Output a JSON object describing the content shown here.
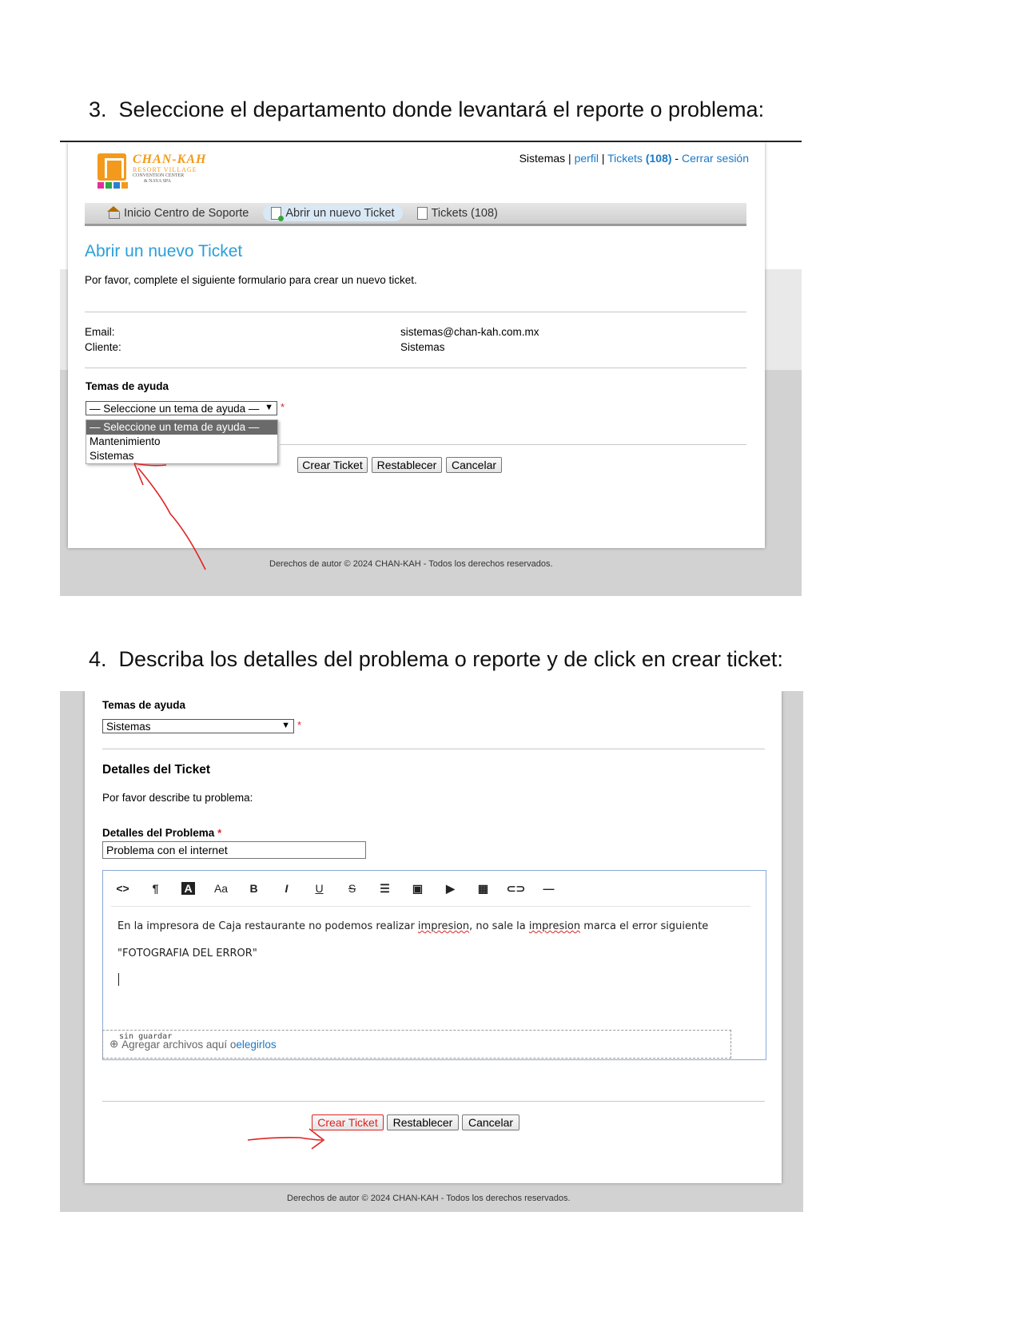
{
  "step3": {
    "number": "3.",
    "heading": "Seleccione el departamento donde levantará el reporte o problema:"
  },
  "step4": {
    "number": "4.",
    "heading": "Describa los detalles del problema o reporte y de click en crear ticket:"
  },
  "logo": {
    "name": "CHAN-KAH",
    "sub1": "RESORT VILLAGE",
    "sub2": "CONVENTION CENTER",
    "sub3": "& NAYA SPA",
    "colors": [
      "#f39a1c",
      "#2aa84a",
      "#e0309a",
      "#2f7fd0"
    ]
  },
  "topbar": {
    "user": "Sistemas",
    "sep1": "|",
    "profile": "perfil",
    "sep2": "|",
    "tickets": "Tickets",
    "tickets_count": "(108)",
    "dash": "-",
    "logout": "Cerrar sesión"
  },
  "nav": {
    "home": "Inicio Centro de Soporte",
    "new_ticket": "Abrir un nuevo Ticket",
    "tickets": "Tickets (108)"
  },
  "form1": {
    "title": "Abrir un nuevo Ticket",
    "intro": "Por favor, complete el siguiente formulario para crear un nuevo ticket.",
    "email_label": "Email:",
    "email_value": "sistemas@chan-kah.com.mx",
    "client_label": "Cliente:",
    "client_value": "Sistemas",
    "topics_label": "Temas de ayuda",
    "select_value": "— Seleccione un tema de ayuda —",
    "required": "*",
    "options": [
      "— Seleccione un tema de ayuda —",
      "Mantenimiento",
      "Sistemas"
    ]
  },
  "buttons": {
    "create": "Crear Ticket",
    "reset": "Restablecer",
    "cancel": "Cancelar"
  },
  "footer": {
    "text": "Derechos de autor © 2024 CHAN-KAH - Todos los derechos reservados."
  },
  "form2": {
    "topics_label": "Temas de ayuda",
    "select_value": "Sistemas",
    "required": "*",
    "details_heading": "Detalles del Ticket",
    "details_intro": "Por favor describe tu problema:",
    "problem_label": "Detalles del Problema",
    "problem_value": "Problema con el internet",
    "toolbar": [
      "<>",
      "¶",
      "A",
      "Aa",
      "B",
      "I",
      "U",
      "S",
      "list",
      "image",
      "video",
      "table",
      "link",
      "hr"
    ],
    "editor_line1_a": "En la impresora de Caja restaurante no podemos realizar ",
    "editor_word1": "impresion",
    "editor_line1_b": ", no sale la ",
    "editor_word2": "impresion",
    "editor_line1_c": " marca el error siguiente",
    "editor_line2": "\"FOTOGRAFIA DEL ERROR\"",
    "editor_status": "sin guardar",
    "dropzone_text": "Agregar archivos aquí o ",
    "dropzone_link": "elegirlos"
  },
  "annotation_color": "#e02020"
}
